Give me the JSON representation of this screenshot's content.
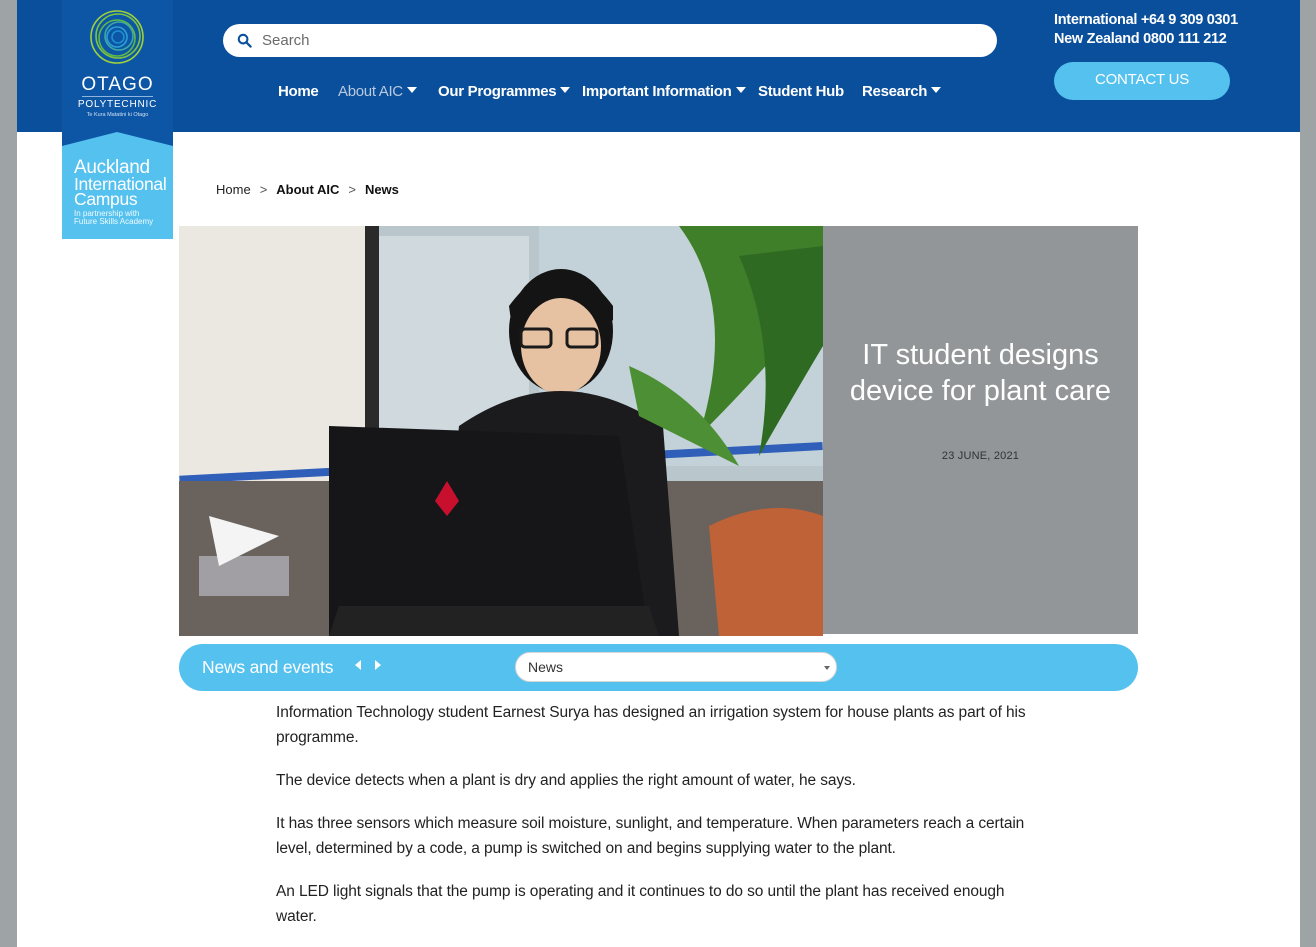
{
  "header": {
    "logo": {
      "brand": "OTAGO",
      "brand_sub": "POLYTECHNIC",
      "tagline": "Te Kura Matatini ki Otago",
      "campus_line1": "Auckland",
      "campus_line2": "International",
      "campus_line3": "Campus",
      "partner_line1": "In partnership with",
      "partner_line2": "Future Skills Academy"
    },
    "search": {
      "placeholder": "Search",
      "icon": "search-icon"
    },
    "nav": [
      {
        "label": "Home",
        "has_dropdown": false
      },
      {
        "label": "About AIC",
        "has_dropdown": true,
        "active": true
      },
      {
        "label": "Our Programmes",
        "has_dropdown": true
      },
      {
        "label": "Important Information",
        "has_dropdown": true
      },
      {
        "label": "Student Hub",
        "has_dropdown": false
      },
      {
        "label": "Research",
        "has_dropdown": true
      }
    ],
    "phone_international": "International +64 9 309 0301",
    "phone_nz": "New Zealand 0800 111 212",
    "contact_label": "CONTACT US"
  },
  "breadcrumb": [
    "Home",
    "About AIC",
    "News"
  ],
  "hero": {
    "title": "IT student designs device for plant care",
    "date": "23 JUNE, 2021"
  },
  "news_bar": {
    "label": "News and events",
    "select_value": "News"
  },
  "article": {
    "paragraphs": [
      "Information Technology student Earnest Surya has designed an irrigation system for house plants as part of his programme.",
      "The device detects when a plant is dry and applies the right amount of water, he says.",
      "It has three sensors which measure soil moisture, sunlight, and temperature.  When parameters reach a certain level, determined by a code, a pump is switched on and begins supplying water to the plant.",
      "An LED light signals that the pump is operating and it continues to do so until the plant has received enough water."
    ]
  },
  "colors": {
    "header_blue": "#0a4f9c",
    "accent_cyan": "#55c1ef",
    "hero_panel_gray": "#939698"
  }
}
